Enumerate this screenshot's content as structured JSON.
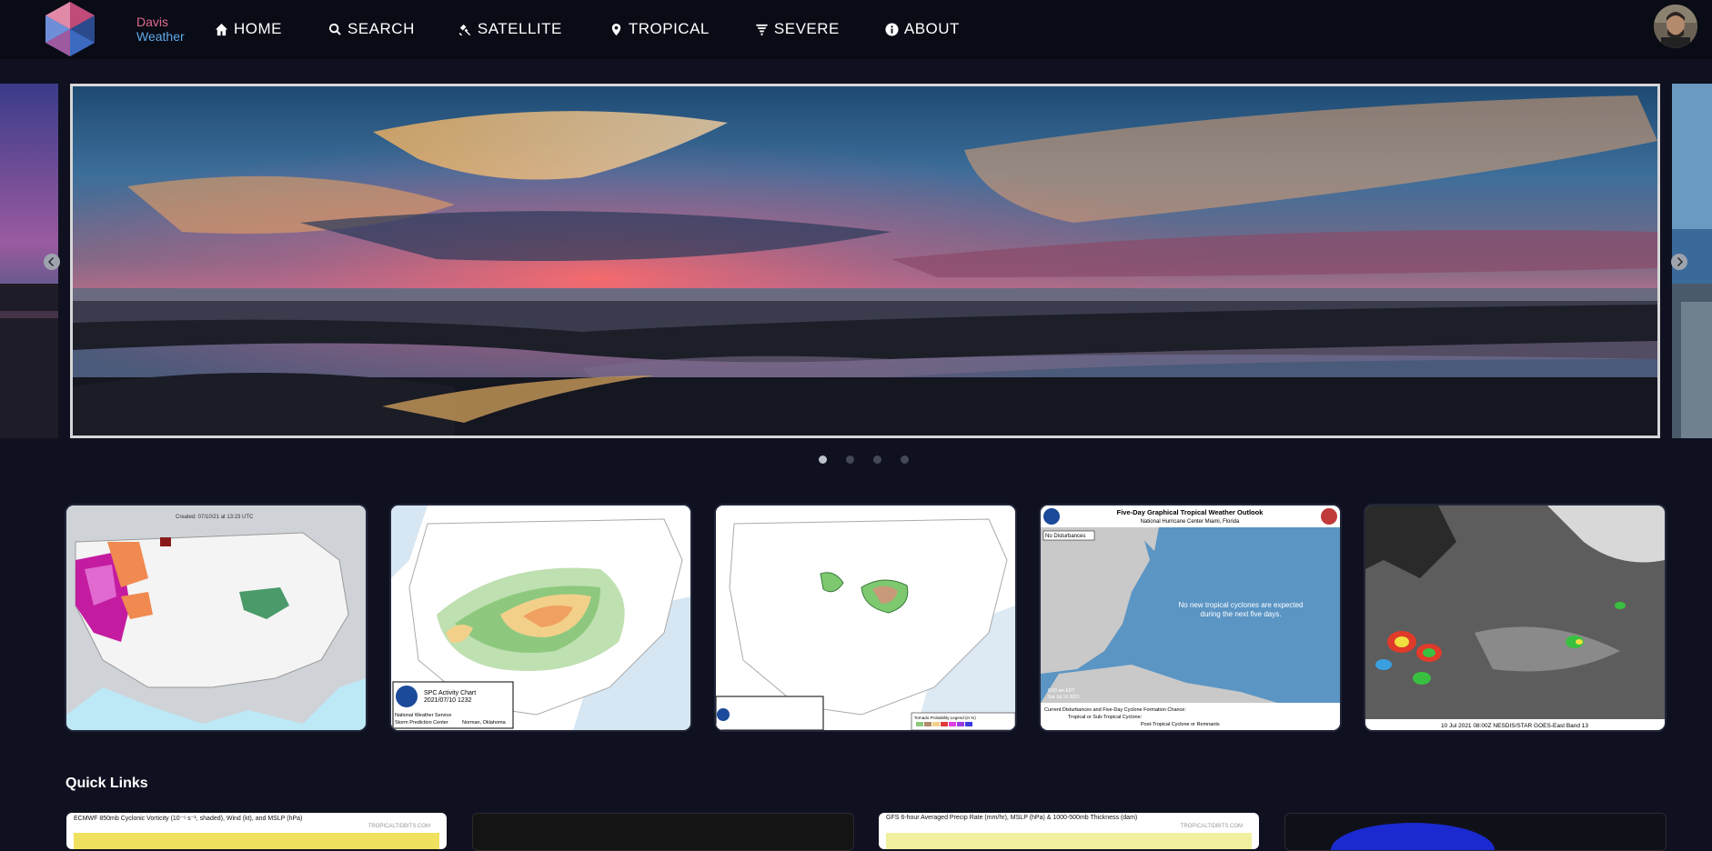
{
  "brand": {
    "line1": "Davis",
    "line2": "Weather"
  },
  "nav": [
    {
      "label": "HOME",
      "icon": "home-icon"
    },
    {
      "label": "SEARCH",
      "icon": "search-icon"
    },
    {
      "label": "SATELLITE",
      "icon": "satellite-icon"
    },
    {
      "label": "TROPICAL",
      "icon": "map-pin-icon"
    },
    {
      "label": "SEVERE",
      "icon": "tornado-icon"
    },
    {
      "label": "ABOUT",
      "icon": "info-icon"
    }
  ],
  "carousel": {
    "slides": 4,
    "active_index": 0
  },
  "thumbnails": {
    "warnings": {
      "caption": "Created: 07/10/21 at 13:23 UTC"
    },
    "spc_activity": {
      "title": "SPC Activity Chart",
      "date": "2021/07/10 1232",
      "footer": "Storm Prediction Center",
      "city": "Norman, Oklahoma",
      "org": "National Weather Service"
    },
    "spc_day1": {
      "legend": "Tornado Probability Legend (in %)"
    },
    "tropical_outlook": {
      "title": "Five-Day Graphical Tropical Weather Outlook",
      "subtitle": "National Hurricane Center  Miami, Florida",
      "badge": "No Disturbances",
      "message_1": "No new tropical cyclones are expected",
      "message_2": "during the next five days.",
      "time_1": "8:00 am EDT",
      "time_2": "Sat Jul 10 2021",
      "footer_1": "Current Disturbances and Five-Day Cyclone Formation Chance:",
      "footer_2": "Tropical or Sub-Tropical Cyclone:",
      "footer_3": "Post-Tropical Cyclone or Remnants"
    },
    "satellite": {
      "caption": "10 Jul 2021 08:00Z NESDIS/STAR GOES-East Band 13"
    }
  },
  "quick_links": {
    "title": "Quick Links",
    "items": [
      {
        "caption": "ECMWF 850mb Cyclonic Vorticity (10⁻⁵ s⁻¹, shaded), Wind (kt), and MSLP (hPa)",
        "source": "TROPICALTIDBITS.COM"
      },
      {
        "caption": "",
        "source": ""
      },
      {
        "caption": "GFS 6-hour Averaged Precip Rate (mm/hr), MSLP (hPa) & 1000-500mb Thickness (dam)",
        "source": "TROPICALTIDBITS.COM"
      },
      {
        "caption": "",
        "source": ""
      }
    ]
  },
  "colors": {
    "background": "#0f1120",
    "navbar": "#090b15",
    "accent_pink": "#e06a8e",
    "accent_blue": "#5fa8e6"
  }
}
